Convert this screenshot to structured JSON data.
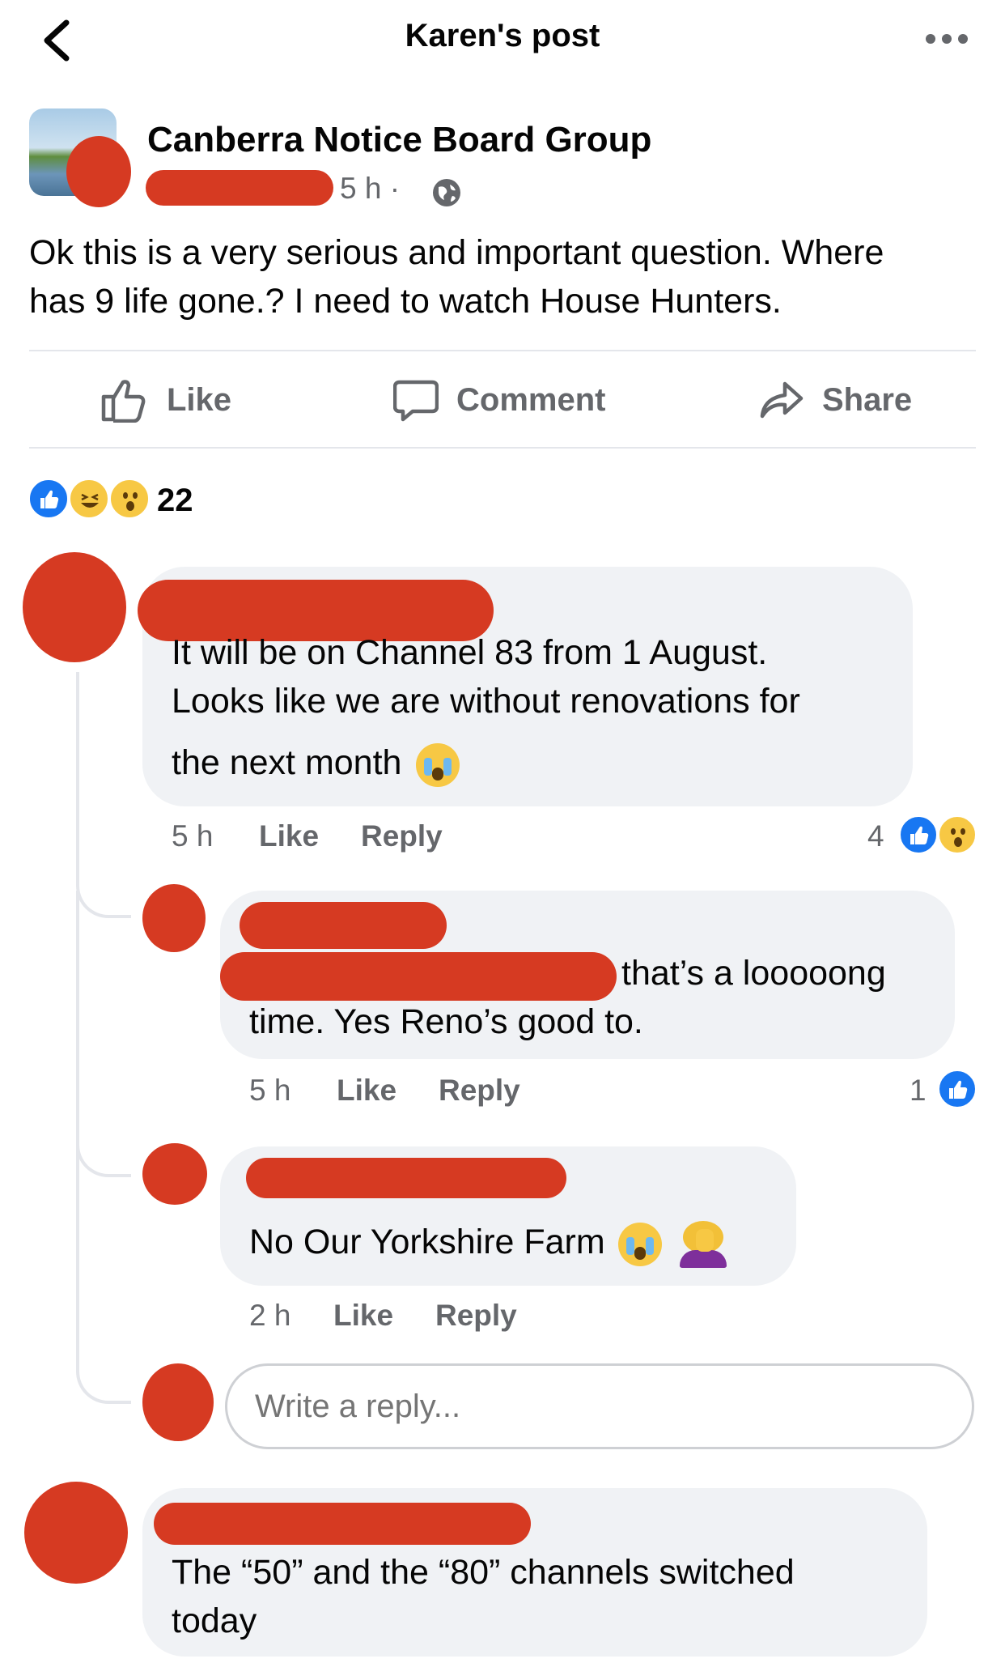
{
  "header": {
    "title": "Karen's post"
  },
  "post": {
    "group_name": "Canberra Notice Board Group",
    "time": "5 h ·",
    "body_line1": "Ok this is a very serious and important question.  Where",
    "body_line2": "has 9 life gone.?  I need to watch House Hunters."
  },
  "actions": {
    "like": "Like",
    "comment": "Comment",
    "share": "Share"
  },
  "reactions": {
    "count": "22"
  },
  "comments": [
    {
      "lines": [
        "It will be on Channel 83 from 1 August.",
        "Looks like we are without renovations for",
        "the next month"
      ],
      "time": "5 h",
      "like": "Like",
      "reply": "Reply",
      "reaction_count": "4"
    },
    {
      "lines": [
        "that’s a looooong",
        "time. Yes Reno’s good to."
      ],
      "time": "5 h",
      "like": "Like",
      "reply": "Reply",
      "reaction_count": "1"
    },
    {
      "lines": [
        "No Our Yorkshire Farm"
      ],
      "time": "2 h",
      "like": "Like",
      "reply": "Reply"
    },
    {
      "lines": [
        "The “50” and the “80” channels switched",
        "today"
      ]
    }
  ],
  "reply_box": {
    "placeholder": "Write a reply..."
  },
  "colors": {
    "redaction": "#d63a22",
    "brand": "#1877f2",
    "bubble": "#f0f2f5",
    "meta": "#65676b"
  }
}
